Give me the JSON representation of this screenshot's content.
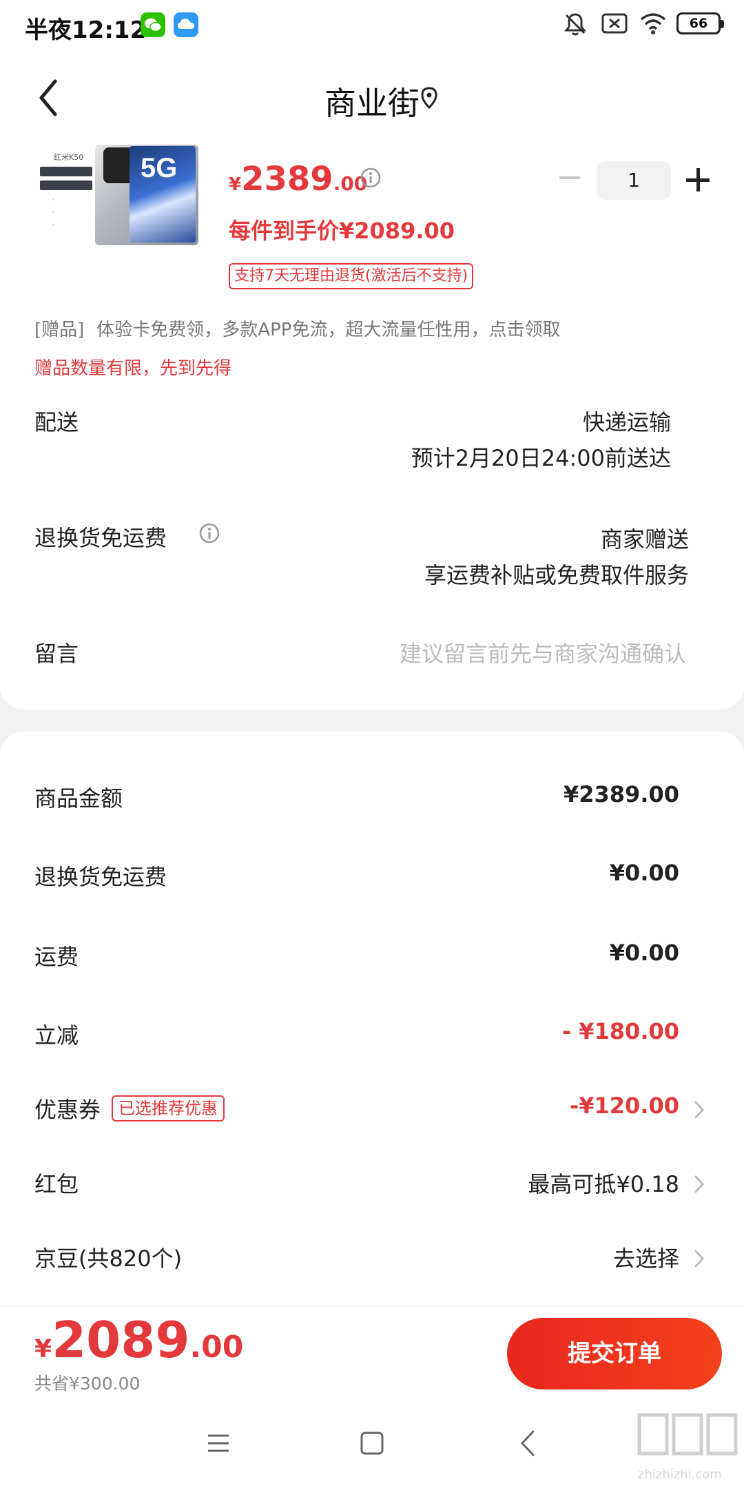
{
  "status_bar": {
    "time": "半夜12:12",
    "battery": "66"
  },
  "header": {
    "title": "商业街"
  },
  "product": {
    "image_brand": "红米K50",
    "image_badge": "5G",
    "price_symbol": "¥",
    "price_integer": "2389",
    "price_decimal": ".00",
    "final_price": "每件到手价¥2089.00",
    "quantity": "1",
    "return_tag": "支持7天无理由退货(激活后不支持)"
  },
  "gift": {
    "label": "[赠品]",
    "text": "体验卡免费领，多款APP免流，超大流量任性用，点击领取",
    "note": "赠品数量有限，先到先得"
  },
  "delivery": {
    "label": "配送",
    "method": "快递运输",
    "eta": "预计2月20日24:00前送达"
  },
  "return_shipping": {
    "label": "退换货免运费",
    "value": "商家赠送",
    "detail": "享运费补贴或免费取件服务"
  },
  "message": {
    "label": "留言",
    "placeholder": "建议留言前先与商家沟通确认"
  },
  "summary": {
    "rows": [
      {
        "label": "商品金额",
        "value": "¥2389.00"
      },
      {
        "label": "退换货免运费",
        "value": "¥0.00"
      },
      {
        "label": "运费",
        "value": "¥0.00"
      },
      {
        "label": "立减",
        "value": "- ¥180.00"
      },
      {
        "label": "优惠券",
        "tag": "已选推荐优惠",
        "value": "-¥120.00"
      },
      {
        "label": "红包",
        "value": "最高可抵¥0.18"
      },
      {
        "label": "京豆(共820个)",
        "value": "去选择"
      }
    ]
  },
  "bottom": {
    "total_symbol": "¥",
    "total_integer": "2089",
    "total_decimal": ".00",
    "saved": "共省¥300.00",
    "submit": "提交订单"
  },
  "watermark": {
    "text": "zhizhizhi.com"
  },
  "colors": {
    "accent": "#e4393c",
    "submit_gradient_start": "#e8281e",
    "submit_gradient_end": "#f4411c"
  },
  "icons": [
    "wechat-icon",
    "cloud-icon",
    "bell-off-icon",
    "sim-off-icon",
    "wifi-icon",
    "battery-icon",
    "back-arrow-icon",
    "location-pin-icon",
    "info-icon",
    "minus-icon",
    "plus-icon",
    "chevron-right-icon",
    "menu-icon",
    "home-icon",
    "back-icon"
  ]
}
